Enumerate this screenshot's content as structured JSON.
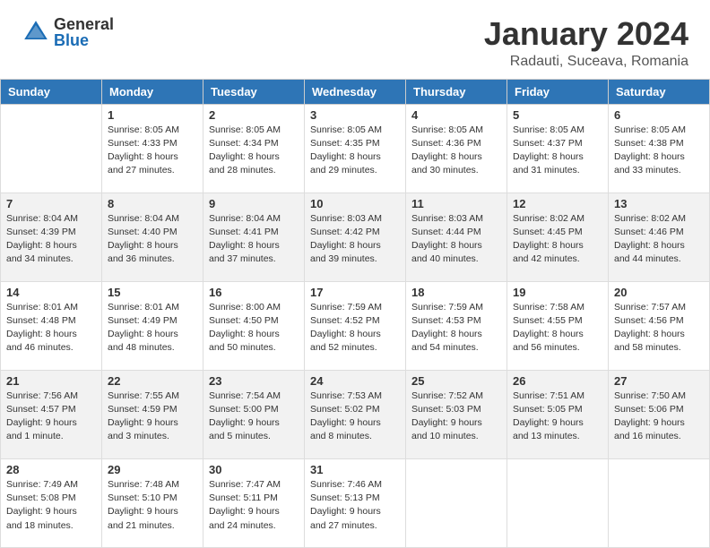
{
  "header": {
    "logo_general": "General",
    "logo_blue": "Blue",
    "month_title": "January 2024",
    "location": "Radauti, Suceava, Romania"
  },
  "days_of_week": [
    "Sunday",
    "Monday",
    "Tuesday",
    "Wednesday",
    "Thursday",
    "Friday",
    "Saturday"
  ],
  "weeks": [
    [
      {
        "day": "",
        "info": ""
      },
      {
        "day": "1",
        "info": "Sunrise: 8:05 AM\nSunset: 4:33 PM\nDaylight: 8 hours\nand 27 minutes."
      },
      {
        "day": "2",
        "info": "Sunrise: 8:05 AM\nSunset: 4:34 PM\nDaylight: 8 hours\nand 28 minutes."
      },
      {
        "day": "3",
        "info": "Sunrise: 8:05 AM\nSunset: 4:35 PM\nDaylight: 8 hours\nand 29 minutes."
      },
      {
        "day": "4",
        "info": "Sunrise: 8:05 AM\nSunset: 4:36 PM\nDaylight: 8 hours\nand 30 minutes."
      },
      {
        "day": "5",
        "info": "Sunrise: 8:05 AM\nSunset: 4:37 PM\nDaylight: 8 hours\nand 31 minutes."
      },
      {
        "day": "6",
        "info": "Sunrise: 8:05 AM\nSunset: 4:38 PM\nDaylight: 8 hours\nand 33 minutes."
      }
    ],
    [
      {
        "day": "7",
        "info": "Sunrise: 8:04 AM\nSunset: 4:39 PM\nDaylight: 8 hours\nand 34 minutes."
      },
      {
        "day": "8",
        "info": "Sunrise: 8:04 AM\nSunset: 4:40 PM\nDaylight: 8 hours\nand 36 minutes."
      },
      {
        "day": "9",
        "info": "Sunrise: 8:04 AM\nSunset: 4:41 PM\nDaylight: 8 hours\nand 37 minutes."
      },
      {
        "day": "10",
        "info": "Sunrise: 8:03 AM\nSunset: 4:42 PM\nDaylight: 8 hours\nand 39 minutes."
      },
      {
        "day": "11",
        "info": "Sunrise: 8:03 AM\nSunset: 4:44 PM\nDaylight: 8 hours\nand 40 minutes."
      },
      {
        "day": "12",
        "info": "Sunrise: 8:02 AM\nSunset: 4:45 PM\nDaylight: 8 hours\nand 42 minutes."
      },
      {
        "day": "13",
        "info": "Sunrise: 8:02 AM\nSunset: 4:46 PM\nDaylight: 8 hours\nand 44 minutes."
      }
    ],
    [
      {
        "day": "14",
        "info": "Sunrise: 8:01 AM\nSunset: 4:48 PM\nDaylight: 8 hours\nand 46 minutes."
      },
      {
        "day": "15",
        "info": "Sunrise: 8:01 AM\nSunset: 4:49 PM\nDaylight: 8 hours\nand 48 minutes."
      },
      {
        "day": "16",
        "info": "Sunrise: 8:00 AM\nSunset: 4:50 PM\nDaylight: 8 hours\nand 50 minutes."
      },
      {
        "day": "17",
        "info": "Sunrise: 7:59 AM\nSunset: 4:52 PM\nDaylight: 8 hours\nand 52 minutes."
      },
      {
        "day": "18",
        "info": "Sunrise: 7:59 AM\nSunset: 4:53 PM\nDaylight: 8 hours\nand 54 minutes."
      },
      {
        "day": "19",
        "info": "Sunrise: 7:58 AM\nSunset: 4:55 PM\nDaylight: 8 hours\nand 56 minutes."
      },
      {
        "day": "20",
        "info": "Sunrise: 7:57 AM\nSunset: 4:56 PM\nDaylight: 8 hours\nand 58 minutes."
      }
    ],
    [
      {
        "day": "21",
        "info": "Sunrise: 7:56 AM\nSunset: 4:57 PM\nDaylight: 9 hours\nand 1 minute."
      },
      {
        "day": "22",
        "info": "Sunrise: 7:55 AM\nSunset: 4:59 PM\nDaylight: 9 hours\nand 3 minutes."
      },
      {
        "day": "23",
        "info": "Sunrise: 7:54 AM\nSunset: 5:00 PM\nDaylight: 9 hours\nand 5 minutes."
      },
      {
        "day": "24",
        "info": "Sunrise: 7:53 AM\nSunset: 5:02 PM\nDaylight: 9 hours\nand 8 minutes."
      },
      {
        "day": "25",
        "info": "Sunrise: 7:52 AM\nSunset: 5:03 PM\nDaylight: 9 hours\nand 10 minutes."
      },
      {
        "day": "26",
        "info": "Sunrise: 7:51 AM\nSunset: 5:05 PM\nDaylight: 9 hours\nand 13 minutes."
      },
      {
        "day": "27",
        "info": "Sunrise: 7:50 AM\nSunset: 5:06 PM\nDaylight: 9 hours\nand 16 minutes."
      }
    ],
    [
      {
        "day": "28",
        "info": "Sunrise: 7:49 AM\nSunset: 5:08 PM\nDaylight: 9 hours\nand 18 minutes."
      },
      {
        "day": "29",
        "info": "Sunrise: 7:48 AM\nSunset: 5:10 PM\nDaylight: 9 hours\nand 21 minutes."
      },
      {
        "day": "30",
        "info": "Sunrise: 7:47 AM\nSunset: 5:11 PM\nDaylight: 9 hours\nand 24 minutes."
      },
      {
        "day": "31",
        "info": "Sunrise: 7:46 AM\nSunset: 5:13 PM\nDaylight: 9 hours\nand 27 minutes."
      },
      {
        "day": "",
        "info": ""
      },
      {
        "day": "",
        "info": ""
      },
      {
        "day": "",
        "info": ""
      }
    ]
  ]
}
